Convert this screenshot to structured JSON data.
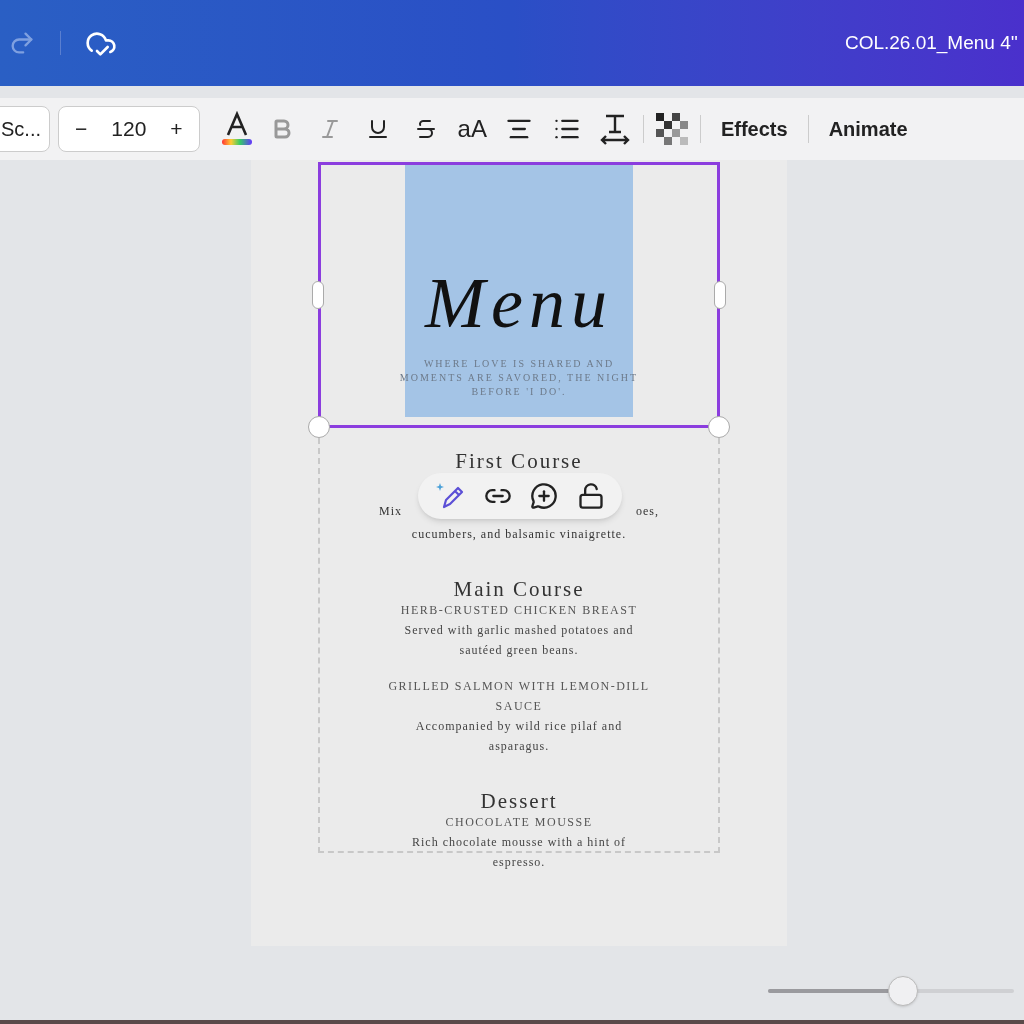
{
  "header": {
    "file_title": "COL.26.01_Menu 4''"
  },
  "toolbar": {
    "font_name": "Sc...",
    "font_size": "120",
    "decrease": "−",
    "increase": "+",
    "case_label": "aA",
    "effects": "Effects",
    "animate": "Animate",
    "bold_disabled": true
  },
  "design": {
    "title": "Menu",
    "title_selected": true,
    "tagline": "WHERE LOVE IS SHARED AND MOMENTS ARE SAVORED, THE NIGHT BEFORE 'I DO'.",
    "first_course": {
      "heading": "First Course",
      "fragments": [
        "Mix",
        "oes,"
      ],
      "description": "cucumbers, and balsamic vinaigrette."
    },
    "sections": [
      {
        "heading": "Main Course",
        "items": [
          {
            "name": "HERB-CRUSTED CHICKEN BREAST",
            "description": "Served with garlic mashed potatoes and sautéed green beans."
          },
          {
            "name": "GRILLED SALMON WITH LEMON-DILL SAUCE",
            "description": "Accompanied by wild rice pilaf and asparagus."
          }
        ]
      },
      {
        "heading": "Dessert",
        "items": [
          {
            "name": "CHOCOLATE MOUSSE",
            "description": "Rich chocolate mousse with a hint of espresso."
          }
        ]
      }
    ]
  },
  "zoom_slider": {
    "level": 0.55
  }
}
